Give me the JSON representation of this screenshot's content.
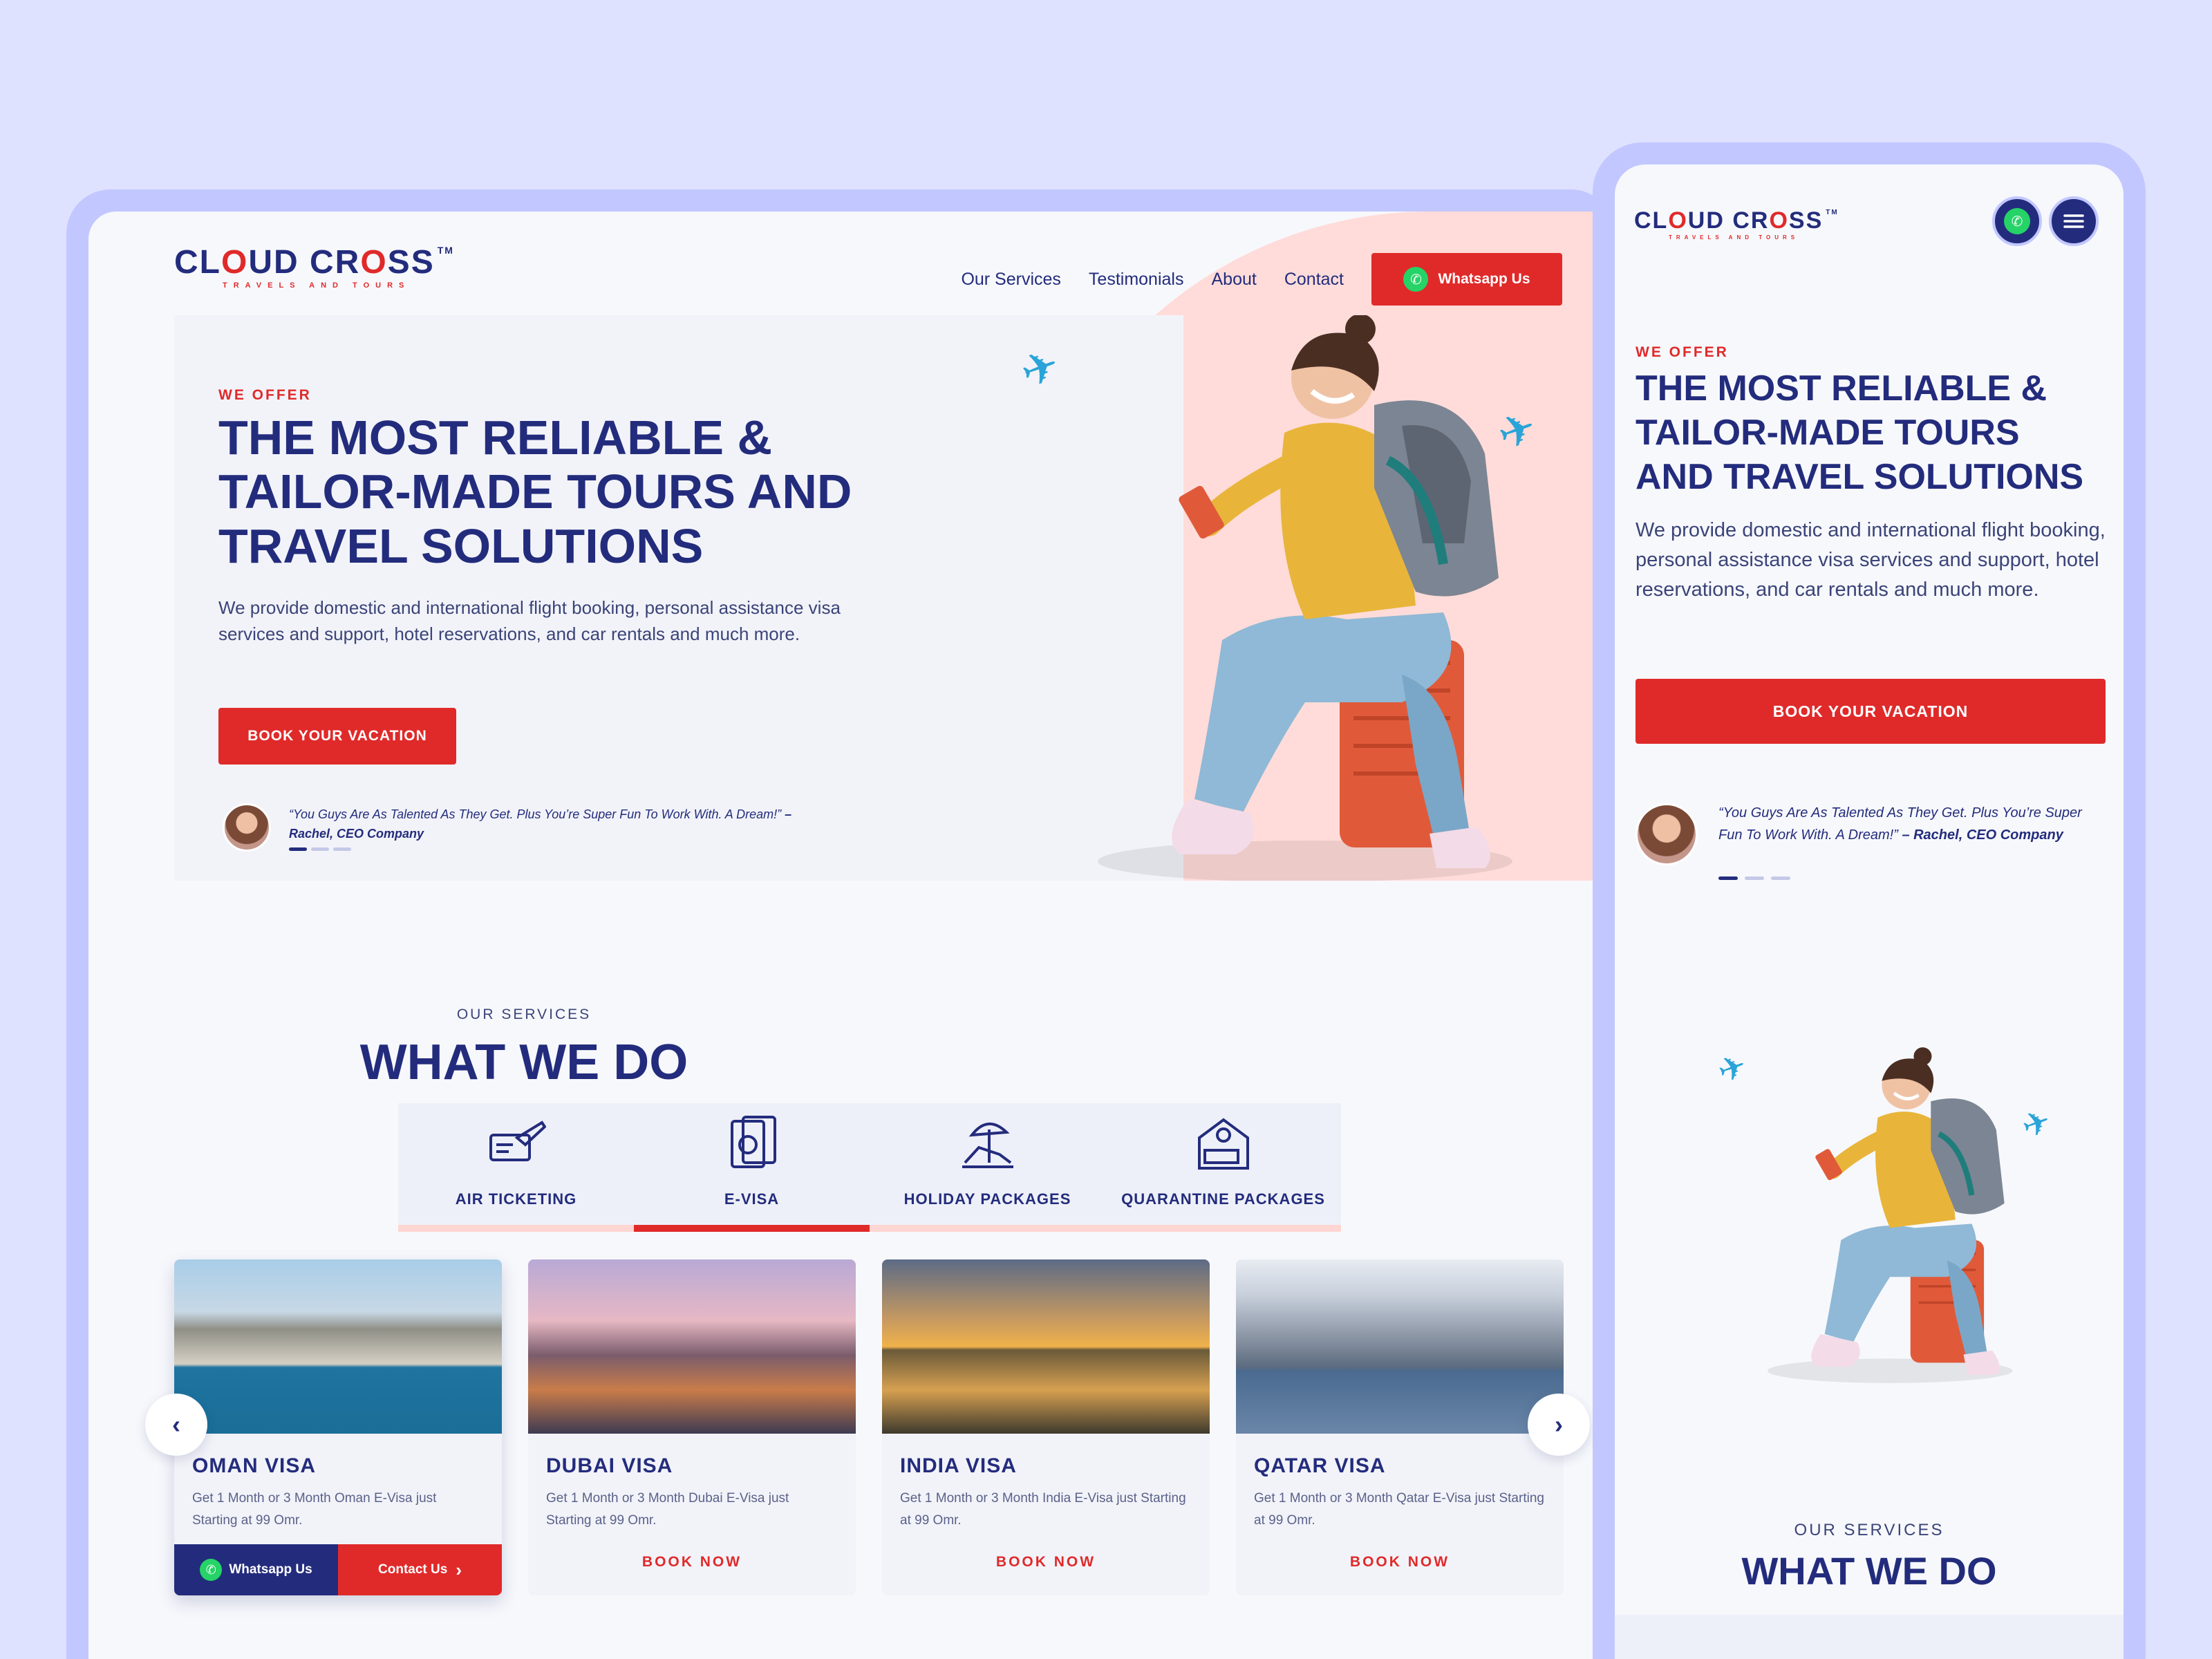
{
  "brand": {
    "name_part1": "CL",
    "name_o1": "O",
    "name_part2": "UD CR",
    "name_o2": "O",
    "name_part3": "SS",
    "tm": "TM",
    "tagline": "TRAVELS AND TOURS"
  },
  "nav": {
    "items": [
      "Our Services",
      "Testimonials",
      "About",
      "Contact"
    ],
    "whatsapp_label": "Whatsapp Us"
  },
  "hero": {
    "eyebrow": "WE OFFER",
    "headline_line1": "THE MOST RELIABLE &",
    "headline_line2": "TAILOR-MADE TOURS AND",
    "headline_line3": "TRAVEL SOLUTIONS",
    "description": "We provide domestic and international flight booking, personal assistance visa services and support, hotel reservations, and car rentals and much more.",
    "cta": "BOOK YOUR VACATION",
    "testimonial_quote": "“You Guys Are As Talented As They Get. Plus You’re Super Fun To Work With. A Dream!”",
    "testimonial_author": "– Rachel, CEO Company"
  },
  "services": {
    "label": "OUR SERVICES",
    "title": "WHAT WE DO",
    "tabs": [
      {
        "label": "AIR TICKETING",
        "icon": "airplane-ticket-icon"
      },
      {
        "label": "E-VISA",
        "icon": "passport-icon"
      },
      {
        "label": "HOLIDAY PACKAGES",
        "icon": "beach-chair-icon"
      },
      {
        "label": "QUARANTINE PACKAGES",
        "icon": "hotel-bed-icon"
      }
    ],
    "active_tab": "E-VISA",
    "cards": [
      {
        "title": "OMAN VISA",
        "desc": "Get 1 Month or 3 Month Oman E-Visa just Starting at 99 Omr.",
        "whatsapp": "Whatsapp Us",
        "contact": "Contact Us"
      },
      {
        "title": "DUBAI VISA",
        "desc": "Get 1 Month or 3 Month Dubai E-Visa just Starting at 99 Omr.",
        "book": "BOOK NOW"
      },
      {
        "title": "INDIA VISA",
        "desc": "Get 1 Month or 3 Month India E-Visa just Starting at 99 Omr.",
        "book": "BOOK NOW"
      },
      {
        "title": "QATAR VISA",
        "desc": "Get 1 Month or 3 Month Qatar E-Visa just Starting at 99 Omr.",
        "book": "BOOK NOW"
      }
    ]
  },
  "mobile": {
    "headline_line1": "THE MOST RELIABLE &",
    "headline_line2": "TAILOR-MADE TOURS",
    "headline_line3": "AND TRAVEL SOLUTIONS",
    "testimonial_quote": "“You Guys Are As Talented As They Get. Plus You’re Super Fun To Work With. A Dream!”"
  },
  "colors": {
    "navy": "#232c7c",
    "red": "#e02a2a",
    "pink": "#ffdcd9",
    "background": "#dfe2ff",
    "whatsapp": "#25d366"
  }
}
